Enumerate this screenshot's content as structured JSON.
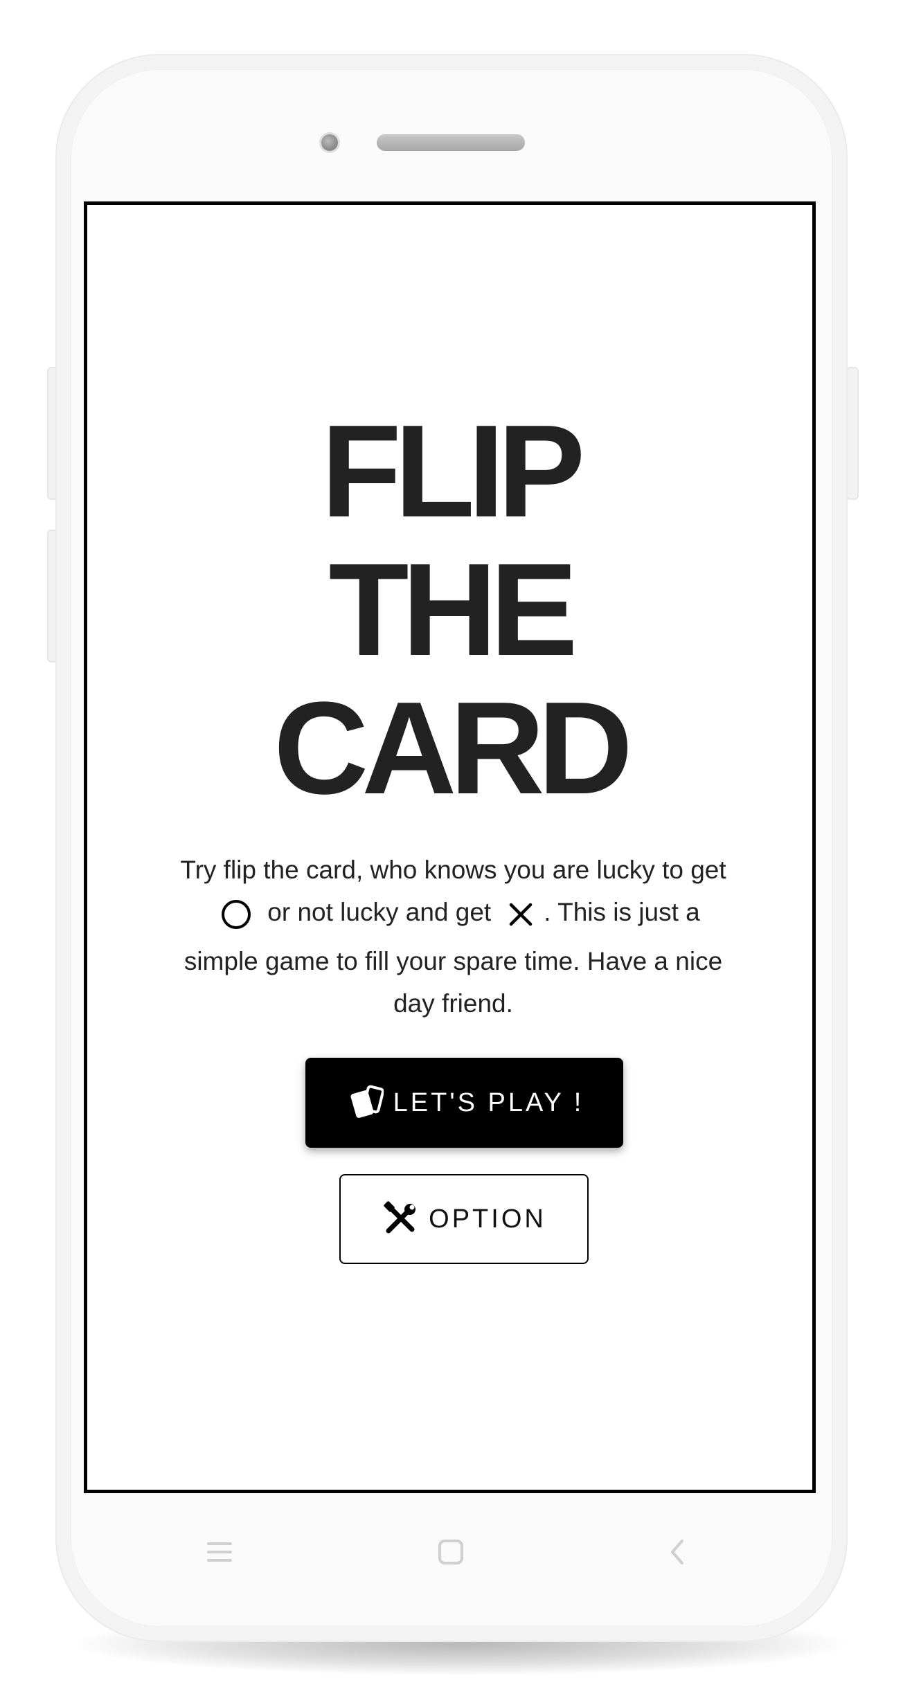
{
  "app": {
    "title_lines": [
      "FLIP",
      "THE",
      "CARD"
    ],
    "description": {
      "part1": "Try flip the card, who knows you are lucky to get",
      "symbol_lucky": "circle-icon",
      "part2": "or not lucky and get",
      "symbol_unlucky": "x-icon",
      "part3": ". This is just a simple game to fill your spare time. Have a nice day friend."
    },
    "play_button": {
      "label": "LET'S PLAY !",
      "icon": "cards-icon"
    },
    "option_button": {
      "label": "OPTION",
      "icon": "tools-icon"
    }
  },
  "device": {
    "nav": {
      "menu_icon": "menu-icon",
      "home_icon": "home-icon",
      "back_icon": "back-icon"
    }
  },
  "colors": {
    "screen_background": "#ffffff",
    "text": "#222222",
    "primary_button": "#000000",
    "primary_button_text": "#ffffff",
    "phone_body": "#f3f3f3"
  }
}
